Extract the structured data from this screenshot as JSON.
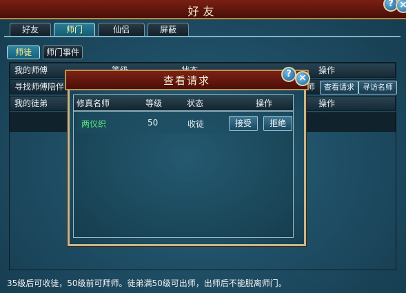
{
  "window": {
    "title": "好友"
  },
  "tabs": [
    "好友",
    "师门",
    "仙侣",
    "屏蔽"
  ],
  "subtabs": [
    "师徒",
    "师门事件"
  ],
  "panel": {
    "rows": [
      {
        "label": "我的师傅",
        "col2": "等级",
        "col3": "状态",
        "col4": "操作"
      },
      {
        "label": "寻找师傅陪伴",
        "col4a": "师",
        "btn1": "查看请求",
        "btn2": "寻访名师"
      },
      {
        "label": "我的徒弟",
        "col4": "操作"
      }
    ]
  },
  "dialog": {
    "title": "查看请求",
    "headers": [
      "修真名师",
      "等级",
      "状态",
      "操作"
    ],
    "entries": [
      {
        "name": "两仪织",
        "level": "50",
        "status": "收徒",
        "accept": "接受",
        "reject": "拒绝"
      }
    ]
  },
  "footer": {
    "text": "35级后可收徒，50级前可拜师。徒弟满50级可出师，出师后不能脱离师门。"
  },
  "colors": {
    "accent": "#7a1f12",
    "highlight_text": "#59e27a",
    "gold_border": "#b98a3c"
  }
}
